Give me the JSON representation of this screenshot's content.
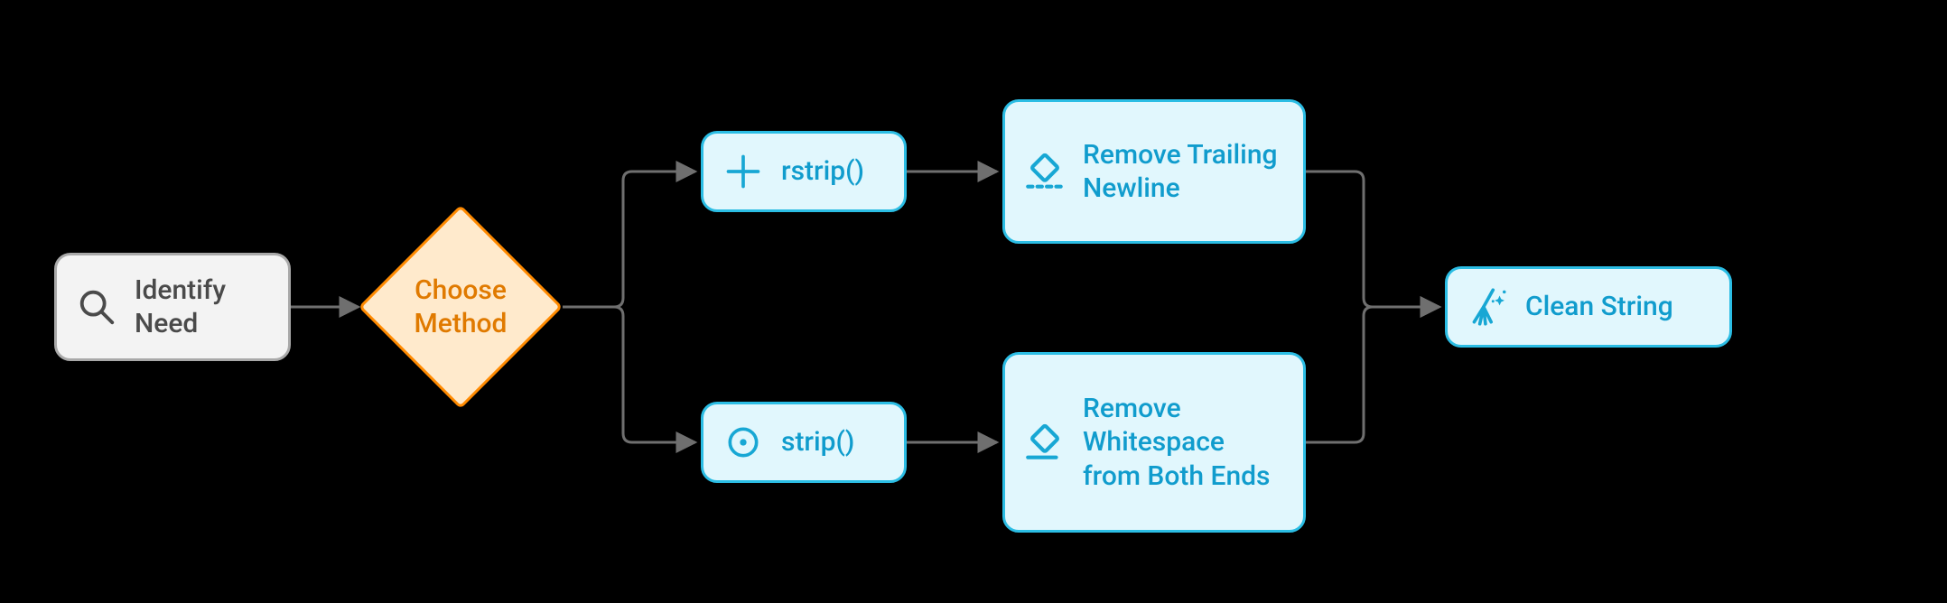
{
  "colors": {
    "cyan_border": "#2bbde4",
    "cyan_fill": "#e1f7fd",
    "cyan_text": "#109ccd",
    "orange_border": "#ff8a00",
    "orange_fill": "#ffeacc",
    "orange_text": "#e07a00",
    "gray_border": "#a9a9a9",
    "gray_fill": "#f3f3f3",
    "gray_text": "#4a4a4a",
    "connector": "#6f6f6f"
  },
  "nodes": {
    "identify": {
      "label": "Identify Need",
      "icon": "search-icon"
    },
    "choose": {
      "label": "Choose Method",
      "icon": null
    },
    "rstrip": {
      "label": "rstrip()",
      "icon": "plus-icon"
    },
    "strip": {
      "label": "strip()",
      "icon": "record-icon"
    },
    "remTrail": {
      "label": "Remove Trailing New­line",
      "icon": "eraser-dashed-icon"
    },
    "remWs": {
      "label": "Remove Whitespace from Both Ends",
      "icon": "eraser-line-icon"
    },
    "clean": {
      "label": "Clean String",
      "icon": "broom-sparkle-icon"
    }
  },
  "edges": [
    {
      "from": "identify",
      "to": "choose"
    },
    {
      "from": "choose",
      "to": "rstrip"
    },
    {
      "from": "choose",
      "to": "strip"
    },
    {
      "from": "rstrip",
      "to": "remTrail"
    },
    {
      "from": "strip",
      "to": "remWs"
    },
    {
      "from": "remTrail",
      "to": "clean"
    },
    {
      "from": "remWs",
      "to": "clean"
    }
  ]
}
